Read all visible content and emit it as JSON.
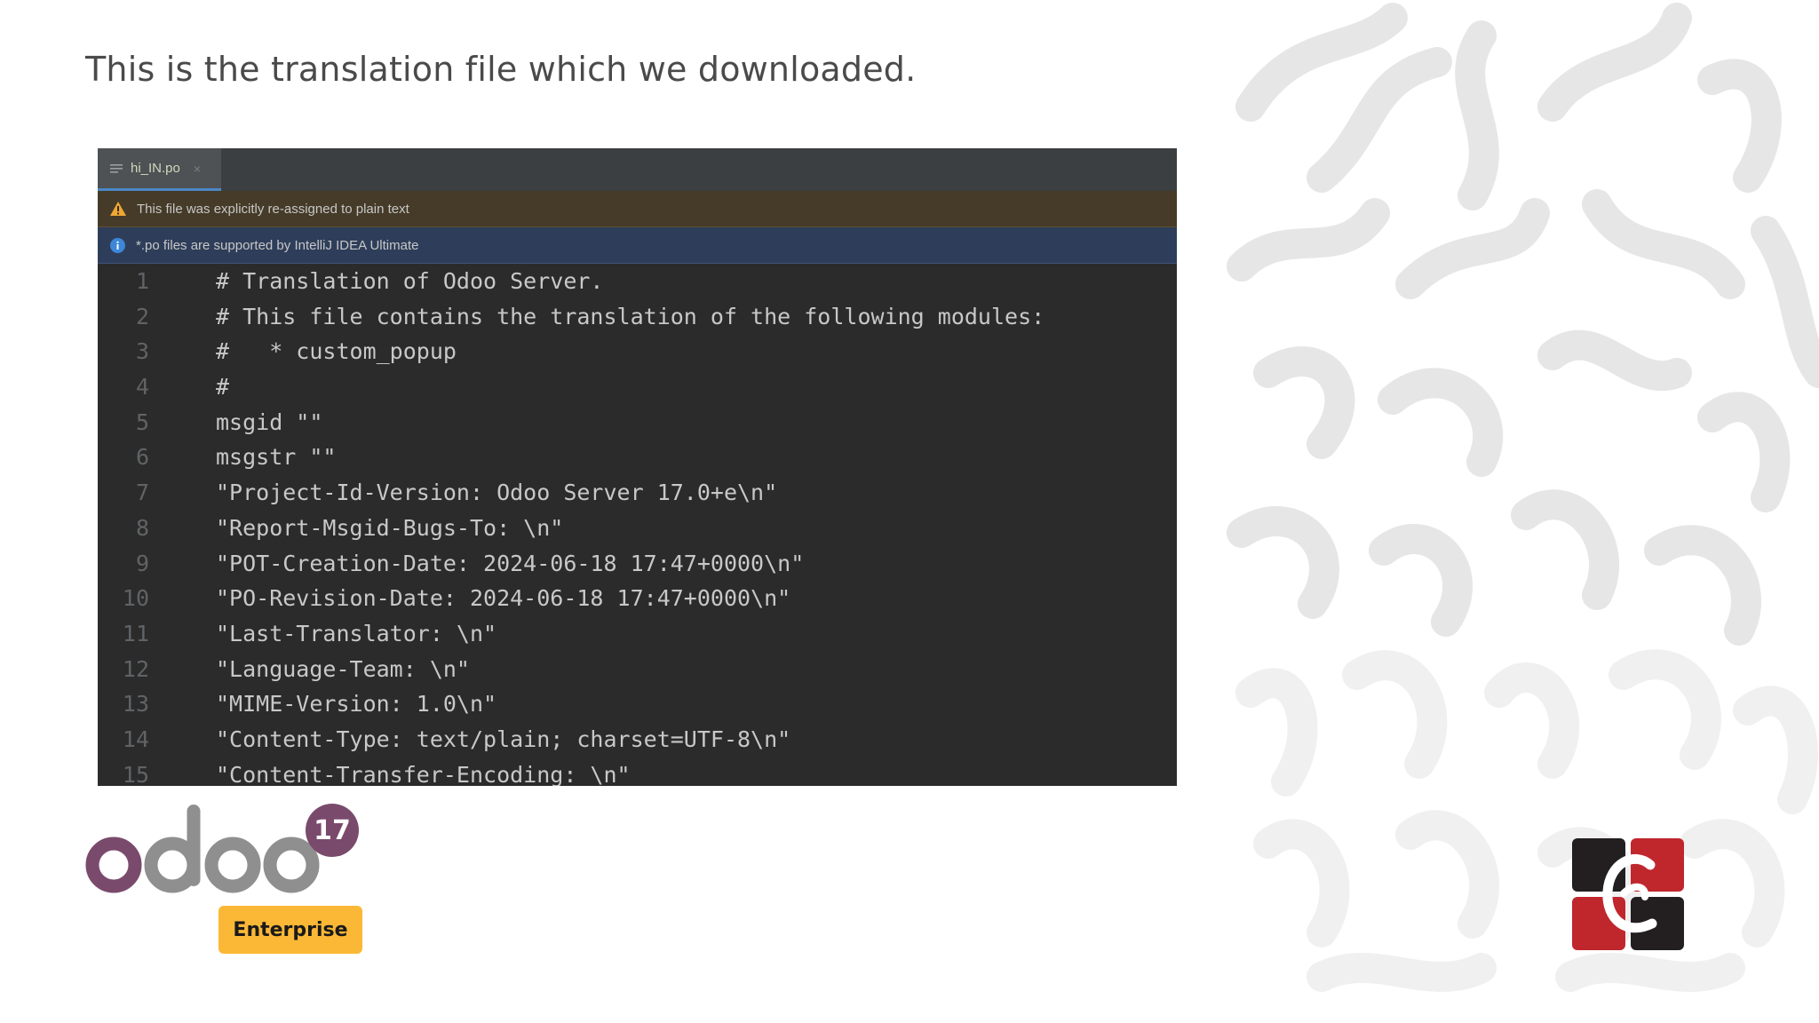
{
  "slide": {
    "title": "This is the translation file which we downloaded."
  },
  "editor": {
    "tab": {
      "filename": "hi_IN.po",
      "close_glyph": "×",
      "icon": "text-file-icon"
    },
    "warning_banner": {
      "text": "This file was explicitly re-assigned to plain text",
      "icon": "warning-icon"
    },
    "info_banner": {
      "text": "*.po files are supported by IntelliJ IDEA Ultimate",
      "icon": "info-icon"
    },
    "lines": [
      {
        "number": "1",
        "text": "# Translation of Odoo Server."
      },
      {
        "number": "2",
        "text": "# This file contains the translation of the following modules:"
      },
      {
        "number": "3",
        "text": "#   * custom_popup"
      },
      {
        "number": "4",
        "text": "#"
      },
      {
        "number": "5",
        "text": "msgid \"\""
      },
      {
        "number": "6",
        "text": "msgstr \"\""
      },
      {
        "number": "7",
        "text": "\"Project-Id-Version: Odoo Server 17.0+e\\n\""
      },
      {
        "number": "8",
        "text": "\"Report-Msgid-Bugs-To: \\n\""
      },
      {
        "number": "9",
        "text": "\"POT-Creation-Date: 2024-06-18 17:47+0000\\n\""
      },
      {
        "number": "10",
        "text": "\"PO-Revision-Date: 2024-06-18 17:47+0000\\n\""
      },
      {
        "number": "11",
        "text": "\"Last-Translator: \\n\""
      },
      {
        "number": "12",
        "text": "\"Language-Team: \\n\""
      },
      {
        "number": "13",
        "text": "\"MIME-Version: 1.0\\n\""
      },
      {
        "number": "14",
        "text": "\"Content-Type: text/plain; charset=UTF-8\\n\""
      },
      {
        "number": "15",
        "text": "\"Content-Transfer-Encoding: \\n\""
      }
    ]
  },
  "branding": {
    "odoo_version": "17",
    "edition": "Enterprise",
    "colors": {
      "odoo_purple": "#7a4a6c",
      "odoo_grey": "#8f8f8f",
      "enterprise_yellow": "#fbb836",
      "company_red": "#c0272d",
      "company_dark": "#231f20"
    }
  }
}
